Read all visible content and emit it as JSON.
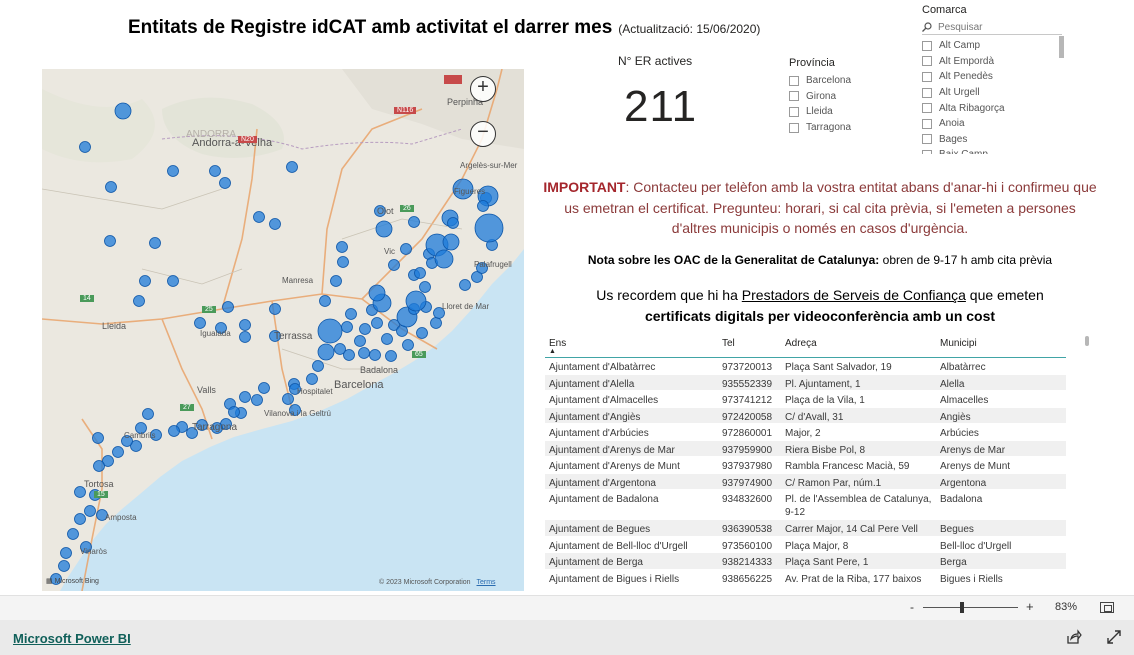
{
  "title": "Entitats de Registre idCAT amb activitat el darrer mes",
  "update_note": "(Actualització: 15/06/2020)",
  "kpi": {
    "label": "N° ER actives",
    "value": "211"
  },
  "provincia": {
    "title": "Província",
    "options": [
      "Barcelona",
      "Girona",
      "Lleida",
      "Tarragona"
    ]
  },
  "comarca": {
    "title": "Comarca",
    "search_placeholder": "Pesquisar",
    "options": [
      "Alt Camp",
      "Alt Empordà",
      "Alt Penedès",
      "Alt Urgell",
      "Alta Ribagorça",
      "Anoia",
      "Bages",
      "Baix Camp"
    ]
  },
  "important": {
    "label": "IMPORTANT",
    "text": ": Contacteu per telèfon amb la vostra entitat abans d'anar-hi i confirmeu que us emetran el certificat. Pregunteu: horari, si cal cita prèvia, si l'emeten a persones d'altres municipis o només en casos d'urgència."
  },
  "note": {
    "bold": "Nota sobre les OAC de la Generalitat de Catalunya:",
    "text": " obren de 9-17 h amb cita prèvia"
  },
  "recordem": {
    "before": "Us recordem que hi ha ",
    "link": "Prestadors de Serveis de Confiança",
    "after": " que emeten",
    "bold": "certificats digitals per videoconferència amb un cost"
  },
  "map": {
    "place_labels": [
      "Andorra-a-Velha",
      "Perpinhà",
      "Figueres",
      "Olot",
      "Lleida",
      "Terrassa",
      "Barcelona",
      "Badalona",
      "Valls",
      "Tarragona",
      "Tortosa",
      "Vilanova i la Geltrú",
      "Hospitalet",
      "Manresa",
      "Igualada",
      "Cambrils",
      "Amposta",
      "Vinaròs",
      "Argelès-sur-Mer",
      "Palafrugell",
      "Lloret de Mar",
      "Vic",
      "ANDORRA",
      "Cambrils"
    ],
    "road_labels": [
      "N20",
      "N116",
      "26",
      "14",
      "25",
      "27",
      "15",
      "65"
    ],
    "credit": "© 2023 Microsoft Corporation",
    "terms": "Terms",
    "bing": "Microsoft Bing",
    "zoom_in": "+",
    "zoom_out": "−"
  },
  "table": {
    "headers": [
      "Ens",
      "Tel",
      "Adreça",
      "Municipi"
    ],
    "rows": [
      [
        "Ajuntament d'Albatàrrec",
        "973720013",
        "Plaça Sant Salvador, 19",
        "Albatàrrec"
      ],
      [
        "Ajuntament d'Alella",
        "935552339",
        "Pl. Ajuntament, 1",
        "Alella"
      ],
      [
        "Ajuntament d'Almacelles",
        "973741212",
        "Plaça de la Vila, 1",
        "Almacelles"
      ],
      [
        "Ajuntament d'Angiès",
        "972420058",
        "C/ d'Avall, 31",
        "Angiès"
      ],
      [
        "Ajuntament d'Arbúcies",
        "972860001",
        "Major, 2",
        "Arbúcies"
      ],
      [
        "Ajuntament d'Arenys de Mar",
        "937959900",
        "Riera Bisbe Pol, 8",
        "Arenys de Mar"
      ],
      [
        "Ajuntament d'Arenys de Munt",
        "937937980",
        "Rambla Francesc Macià, 59",
        "Arenys de Munt"
      ],
      [
        "Ajuntament d'Argentona",
        "937974900",
        "C/ Ramon Par, núm.1",
        "Argentona"
      ],
      [
        "Ajuntament de Badalona",
        "934832600",
        "Pl. de l'Assemblea de Catalunya, 9-12",
        "Badalona"
      ],
      [
        "Ajuntament de Begues",
        "936390538",
        "Carrer Major, 14 Cal Pere Vell",
        "Begues"
      ],
      [
        "Ajuntament de Bell-lloc d'Urgell",
        "973560100",
        "Plaça Major, 8",
        "Bell-lloc d'Urgell"
      ],
      [
        "Ajuntament de Berga",
        "938214333",
        "Plaça Sant Pere, 1",
        "Berga"
      ],
      [
        "Ajuntament de Bigues i Riells",
        "938656225",
        "Av. Prat de la Riba, 177 baixos",
        "Bigues i Riells"
      ]
    ]
  },
  "zoom": {
    "minus": "-",
    "plus": "+",
    "percent": "83%"
  },
  "footer": {
    "link": "Microsoft Power BI"
  },
  "colors": {
    "marker": "#1e7bd9",
    "accent": "#41a4a6",
    "important": "#a4262c"
  }
}
